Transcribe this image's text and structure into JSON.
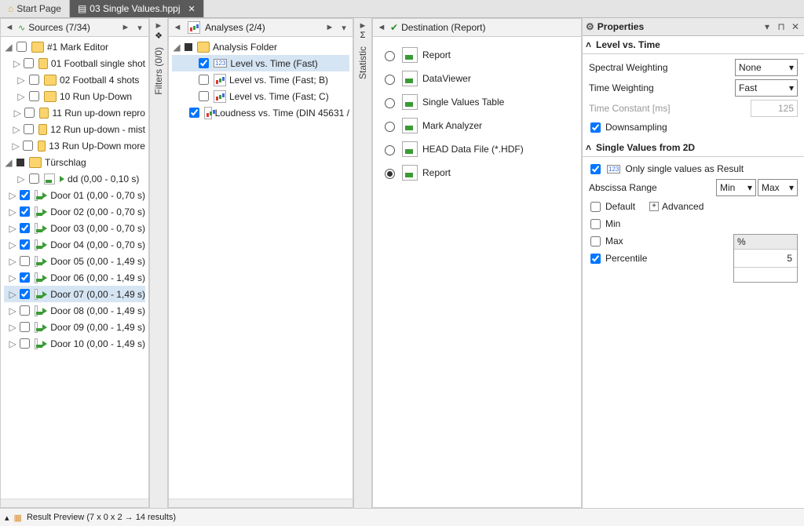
{
  "tabs": {
    "start": "Start Page",
    "active": "03 Single Values.hppj"
  },
  "panels": {
    "sources": {
      "title": "Sources (7/34)",
      "sideStrip": "Filters (0/0)"
    },
    "analyses": {
      "title": "Analyses (2/4)",
      "sideStrip": "Statistic"
    },
    "destination": {
      "title": "Destination (Report)"
    }
  },
  "sourcesTree": {
    "root": {
      "expanded": true,
      "label": "#1 Mark Editor"
    },
    "folders": [
      {
        "label": "01 Football single shot"
      },
      {
        "label": "02 Football 4 shots"
      },
      {
        "label": "10 Run Up-Down"
      },
      {
        "label": "11 Run up-down repro"
      },
      {
        "label": "12 Run up-down - mist"
      },
      {
        "label": "13 Run Up-Down more"
      }
    ],
    "tuerschlag": {
      "label": "Türschlag",
      "expanded": true
    },
    "items": [
      {
        "label": "dd (0,00 - 0,10 s)",
        "checked": false
      },
      {
        "label": "Door 01 (0,00 - 0,70 s)",
        "checked": true
      },
      {
        "label": "Door 02 (0,00 - 0,70 s)",
        "checked": true
      },
      {
        "label": "Door 03 (0,00 - 0,70 s)",
        "checked": true
      },
      {
        "label": "Door 04 (0,00 - 0,70 s)",
        "checked": true
      },
      {
        "label": "Door 05 (0,00 - 1,49 s)",
        "checked": false
      },
      {
        "label": "Door 06 (0,00 - 1,49 s)",
        "checked": true
      },
      {
        "label": "Door 07 (0,00 - 1,49 s)",
        "checked": true,
        "selected": true
      },
      {
        "label": "Door 08 (0,00 - 1,49 s)",
        "checked": false
      },
      {
        "label": "Door 09 (0,00 - 1,49 s)",
        "checked": false
      },
      {
        "label": "Door 10 (0,00 - 1,49 s)",
        "checked": false
      }
    ]
  },
  "analysesTree": {
    "root": {
      "label": "Analysis Folder",
      "checked": true,
      "expanded": true
    },
    "items": [
      {
        "label": "Level vs. Time (Fast)",
        "checked": true,
        "kind": "123",
        "selected": true
      },
      {
        "label": "Level vs. Time (Fast; B)",
        "checked": false,
        "kind": "chart"
      },
      {
        "label": "Level vs. Time (Fast; C)",
        "checked": false,
        "kind": "chart"
      },
      {
        "label": "Loudness vs. Time (DIN 45631 /",
        "checked": true,
        "kind": "chart"
      }
    ]
  },
  "destinations": [
    {
      "label": "Report",
      "selected": false
    },
    {
      "label": "DataViewer",
      "selected": false
    },
    {
      "label": "Single Values Table",
      "selected": false
    },
    {
      "label": "Mark Analyzer",
      "selected": false
    },
    {
      "label": "HEAD Data File (*.HDF)",
      "selected": false
    },
    {
      "label": "Report",
      "selected": true
    }
  ],
  "properties": {
    "title": "Properties",
    "section1": "Level vs. Time",
    "spectralWeighting": {
      "label": "Spectral Weighting",
      "value": "None"
    },
    "timeWeighting": {
      "label": "Time Weighting",
      "value": "Fast"
    },
    "timeConstant": {
      "label": "Time Constant [ms]",
      "value": "125"
    },
    "downsampling": {
      "label": "Downsampling",
      "checked": true
    },
    "section2": "Single Values from 2D",
    "onlySingle": {
      "label": "Only single values as Result",
      "checked": true
    },
    "abscissa": {
      "label": "Abscissa Range",
      "min": "Min",
      "max": "Max"
    },
    "defaultLbl": "Default",
    "advancedLbl": "Advanced",
    "minLbl": "Min",
    "maxLbl": "Max",
    "percentile": {
      "label": "Percentile",
      "header": "%",
      "value": "5"
    }
  },
  "footer": "Result Preview (7 x 0 x 2 → 14 results)"
}
